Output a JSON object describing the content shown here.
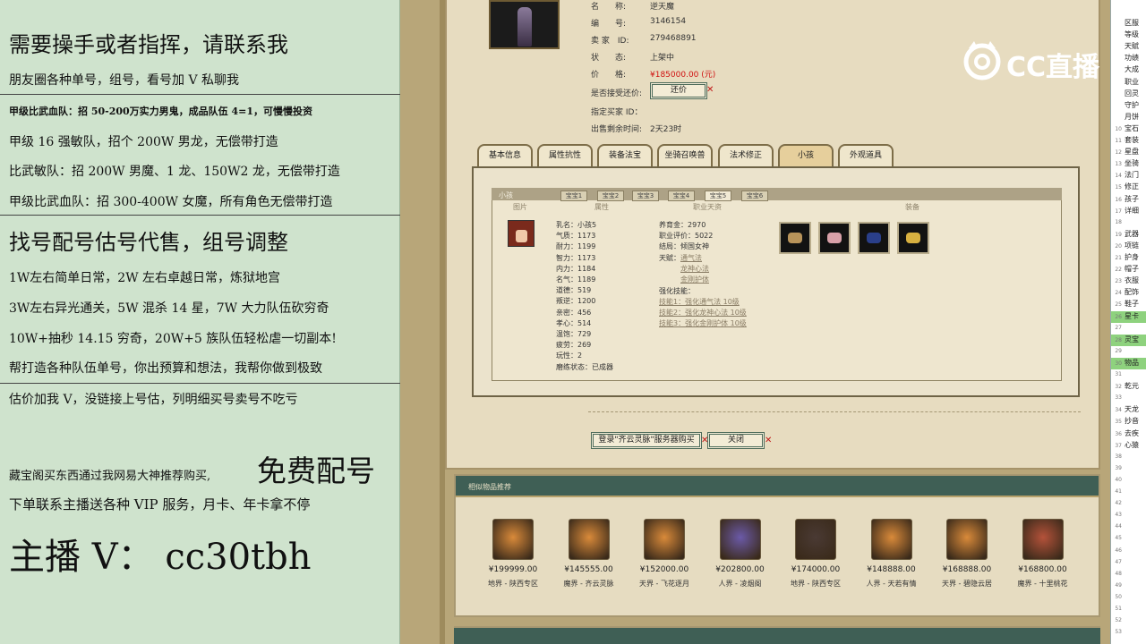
{
  "ad": {
    "l1": "需要操手或者指挥，请联系我",
    "l2": "朋友圈各种单号，组号，看号加 V 私聊我",
    "l3": "甲级比武血队：招 50-200万实力男鬼，成品队伍 4=1，可慢慢投资",
    "l4": "甲级 16 强敏队，招个 200W 男龙，无偿带打造",
    "l5": "比武敏队：招 200W 男魔、1 龙、150W2 龙，无偿带打造",
    "l6": "甲级比武血队：招 300-400W 女魔，所有角色无偿带打造",
    "l7": "找号配号估号代售，组号调整",
    "l8": "1W左右简单日常，2W 左右卓越日常，炼狱地宫",
    "l9": "3W左右异光通关，5W 混杀 14 星，7W 大力队伍砍穷奇",
    "l10": "10W+抽秒 14.15 穷奇，20W+5 族队伍轻松虐一切副本!",
    "l11": "帮打造各种队伍单号，你出预算和想法，我帮你做到极致",
    "l12": "估价加我 V，没链接上号估，列明细买号卖号不吃亏",
    "l13a": "藏宝阁买东西通过我网易大神推荐购买,",
    "l13b": "免费配号",
    "l14": "下单联系主播送各种 VIP 服务，月卡、年卡拿不停",
    "l15": "主播 V： cc30tbh"
  },
  "watermark": "CC直播",
  "detail": {
    "name_label": "名　　称:",
    "name": "逆天魔",
    "id_label": "编　　号:",
    "id": "3146154",
    "seller_label": "卖 家　ID:",
    "seller": "279468891",
    "status_label": "状　　态:",
    "status": "上架中",
    "price_label": "价　　格:",
    "price": "¥185000.00 (元)",
    "bargain_label": "是否接受还价:",
    "bargain_btn": "还价",
    "buyer_label": "指定买家 ID：",
    "remain_label": "出售剩余时间:",
    "remain": "2天23时"
  },
  "tabs": [
    "基本信息",
    "属性抗性",
    "装备法宝",
    "坐骑召唤兽",
    "法术修正",
    "小孩",
    "外观道具"
  ],
  "child": {
    "header": "小孩",
    "subtabs": [
      "宝宝1",
      "宝宝2",
      "宝宝3",
      "宝宝4",
      "宝宝5",
      "宝宝6"
    ],
    "cols": [
      "图片",
      "属性",
      "职业天资",
      "装备"
    ],
    "stats": [
      "乳名：小孩5",
      "气质：1173",
      "耐力：1199",
      "智力：1173",
      "内力：1184",
      "名气：1189",
      "道德：519",
      "叛逆：1200",
      "亲密：456",
      "孝心：514",
      "温饱：729",
      "疲劳：269",
      "玩性：2",
      "磨练状态：已成器"
    ],
    "career": [
      "养育金：2970",
      "职业评价：5022",
      "结局：倾国女神"
    ],
    "skills_label": "天赋：",
    "skills": [
      "通气法",
      "龙神心法",
      "金刚护体"
    ],
    "boost_label": "强化技能：",
    "boosts": [
      "技能1：强化通气法 10级",
      "技能2：强化龙神心法 10级",
      "技能3：强化金刚护体 10级"
    ]
  },
  "buttons": {
    "login": "登录\"齐云灵脉\"服务器购买",
    "close": "关闭"
  },
  "rec": {
    "title": "相似物品推荐",
    "items": [
      {
        "price": "¥199999.00",
        "zone": "地界 - 陕西专区",
        "color": "#d98a3a"
      },
      {
        "price": "¥145555.00",
        "zone": "魔界 - 齐云灵脉",
        "color": "#d98a3a"
      },
      {
        "price": "¥152000.00",
        "zone": "天界 - 飞花逐月",
        "color": "#d98a3a"
      },
      {
        "price": "¥202800.00",
        "zone": "人界 - 凌烟阁",
        "color": "#6b5aa8"
      },
      {
        "price": "¥174000.00",
        "zone": "地界 - 陕西专区",
        "color": "#4a3a34"
      },
      {
        "price": "¥148888.00",
        "zone": "人界 - 天若有情",
        "color": "#d98a3a"
      },
      {
        "price": "¥168888.00",
        "zone": "天界 - 碧隐云居",
        "color": "#d98a3a"
      },
      {
        "price": "¥168800.00",
        "zone": "魔界 - 十里桃花",
        "color": "#b4523a"
      }
    ]
  },
  "side": [
    {
      "n": "",
      "t": "区服"
    },
    {
      "n": "",
      "t": "等级"
    },
    {
      "n": "",
      "t": "天赋"
    },
    {
      "n": "",
      "t": "功绩"
    },
    {
      "n": "",
      "t": "大成"
    },
    {
      "n": "",
      "t": "职业"
    },
    {
      "n": "",
      "t": "回灵"
    },
    {
      "n": "",
      "t": "守护"
    },
    {
      "n": "",
      "t": "月饼"
    },
    {
      "n": "10",
      "t": "宝石"
    },
    {
      "n": "11",
      "t": "套装"
    },
    {
      "n": "12",
      "t": "星盘"
    },
    {
      "n": "13",
      "t": "坐骑"
    },
    {
      "n": "14",
      "t": "法门"
    },
    {
      "n": "15",
      "t": "修正"
    },
    {
      "n": "16",
      "t": "孩子"
    },
    {
      "n": "17",
      "t": "详细"
    },
    {
      "n": "18",
      "t": ""
    },
    {
      "n": "19",
      "t": "武器"
    },
    {
      "n": "20",
      "t": "项链"
    },
    {
      "n": "21",
      "t": "护身"
    },
    {
      "n": "22",
      "t": "帽子"
    },
    {
      "n": "23",
      "t": "衣服"
    },
    {
      "n": "24",
      "t": "配饰"
    },
    {
      "n": "25",
      "t": "鞋子"
    },
    {
      "n": "26",
      "t": "星卡"
    },
    {
      "n": "27",
      "t": ""
    },
    {
      "n": "28",
      "t": "灵宝"
    },
    {
      "n": "29",
      "t": ""
    },
    {
      "n": "30",
      "t": "物品"
    },
    {
      "n": "31",
      "t": ""
    },
    {
      "n": "32",
      "t": "乾元"
    },
    {
      "n": "33",
      "t": ""
    },
    {
      "n": "34",
      "t": "天龙"
    },
    {
      "n": "35",
      "t": "抄音"
    },
    {
      "n": "36",
      "t": "去疾"
    },
    {
      "n": "37",
      "t": "心猿"
    },
    {
      "n": "38",
      "t": ""
    },
    {
      "n": "39",
      "t": ""
    },
    {
      "n": "40",
      "t": ""
    },
    {
      "n": "41",
      "t": ""
    },
    {
      "n": "42",
      "t": ""
    },
    {
      "n": "43",
      "t": ""
    },
    {
      "n": "44",
      "t": ""
    },
    {
      "n": "45",
      "t": ""
    },
    {
      "n": "46",
      "t": ""
    },
    {
      "n": "47",
      "t": ""
    },
    {
      "n": "48",
      "t": ""
    },
    {
      "n": "49",
      "t": ""
    },
    {
      "n": "50",
      "t": ""
    },
    {
      "n": "51",
      "t": ""
    },
    {
      "n": "52",
      "t": ""
    },
    {
      "n": "53",
      "t": ""
    }
  ]
}
